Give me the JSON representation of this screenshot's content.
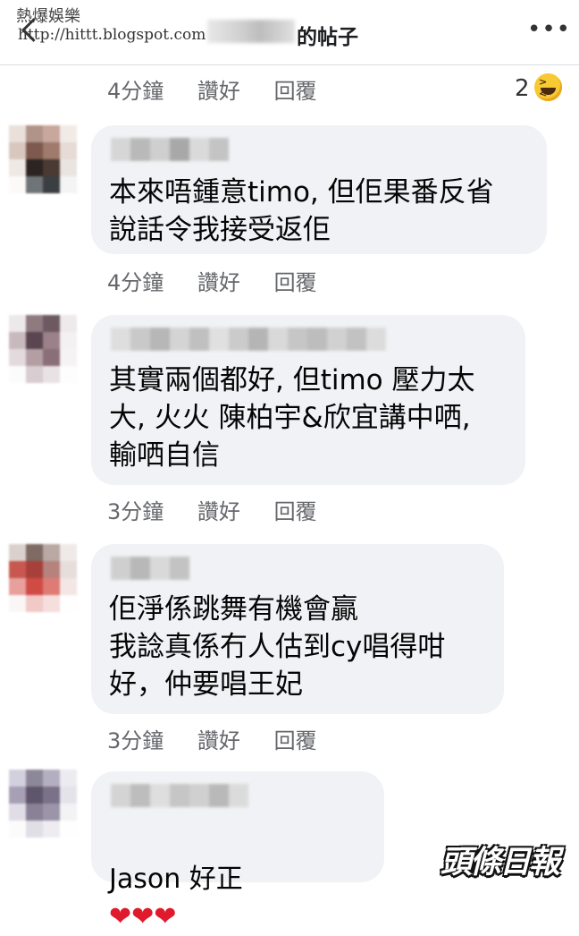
{
  "header": {
    "watermark_line1": "熱爆娛樂",
    "watermark_line2": "http://hittt.blogspot.com",
    "title_suffix": "的帖子",
    "more": "•••",
    "back_icon": "chevron-left-icon",
    "more_icon": "more-dots-icon"
  },
  "top_actions": {
    "time": "4分鐘",
    "like": "讚好",
    "reply": "回覆",
    "reaction_count": "2",
    "reaction_icon": "laugh-emoji-icon"
  },
  "comments": [
    {
      "text": "本來唔鍾意timo, 但佢果番反省\n說話令我接受返佢",
      "time": "4分鐘",
      "like": "讚好",
      "reply": "回覆"
    },
    {
      "text": "其實兩個都好, 但timo 壓力太\n大, 火火 陳柏宇&欣宜講中哂,\n輸哂自信",
      "time": "3分鐘",
      "like": "讚好",
      "reply": "回覆"
    },
    {
      "text": "佢淨係跳舞有機會贏\n我諗真係冇人估到cy唱得咁\n好，仲要唱王妃",
      "time": "3分鐘",
      "like": "讚好",
      "reply": "回覆"
    },
    {
      "text": "Jason 好正",
      "hearts": "❤❤❤"
    }
  ],
  "logo_text": "頭條日報",
  "colors": {
    "bubble": "#f0f2f5",
    "meta": "#65676b",
    "heart": "#e0192c"
  }
}
